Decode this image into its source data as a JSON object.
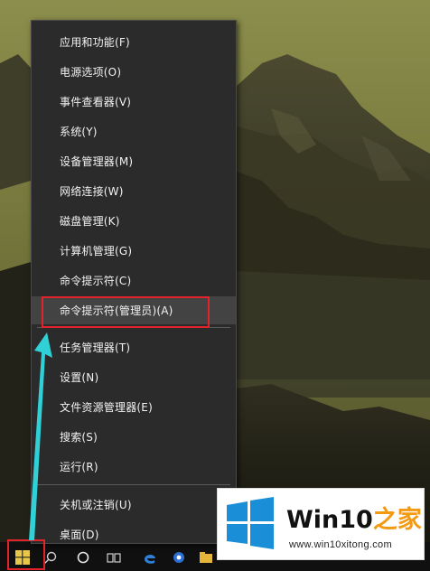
{
  "context_menu": {
    "items": [
      {
        "label": "应用和功能(F)"
      },
      {
        "label": "电源选项(O)"
      },
      {
        "label": "事件查看器(V)"
      },
      {
        "label": "系统(Y)"
      },
      {
        "label": "设备管理器(M)"
      },
      {
        "label": "网络连接(W)"
      },
      {
        "label": "磁盘管理(K)"
      },
      {
        "label": "计算机管理(G)"
      },
      {
        "label": "命令提示符(C)"
      },
      {
        "label": "命令提示符(管理员)(A)",
        "selected": true
      },
      {
        "label": "任务管理器(T)"
      },
      {
        "label": "设置(N)"
      },
      {
        "label": "文件资源管理器(E)"
      },
      {
        "label": "搜索(S)"
      },
      {
        "label": "运行(R)"
      },
      {
        "label": "关机或注销(U)"
      },
      {
        "label": "桌面(D)"
      }
    ]
  },
  "annotations": {
    "highlight_color": "#e3232c",
    "arrow_color": "#2fd0d6"
  },
  "watermark": {
    "brand_prefix": "Win10",
    "brand_suffix": "之家",
    "url": "www.win10xitong.com",
    "brand_accent_color": "#f49a12",
    "logo_color": "#1a8fd8"
  },
  "taskbar": {
    "icons": [
      "windows-logo-icon",
      "search-icon",
      "task-view-icon",
      "edge-icon",
      "chrome-icon",
      "explorer-icon"
    ]
  }
}
